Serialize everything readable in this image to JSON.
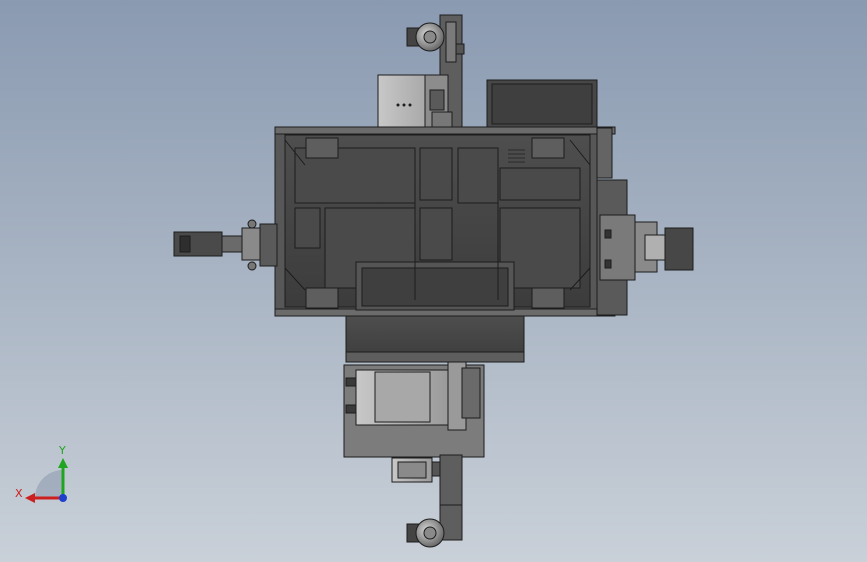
{
  "view": {
    "background_top": "#8a9ab1",
    "background_bottom": "#c9d0d8"
  },
  "triad": {
    "x_label": "X",
    "y_label": "Y",
    "x_color": "#cc1f1f",
    "y_color": "#1fa51f",
    "z_color": "#1f3fcc"
  },
  "model": {
    "body_color": "#5a5a5a",
    "edge_color": "#1c1c1c",
    "panel_color": "#6b6b6b",
    "light_part_color": "#b4b4b4"
  }
}
